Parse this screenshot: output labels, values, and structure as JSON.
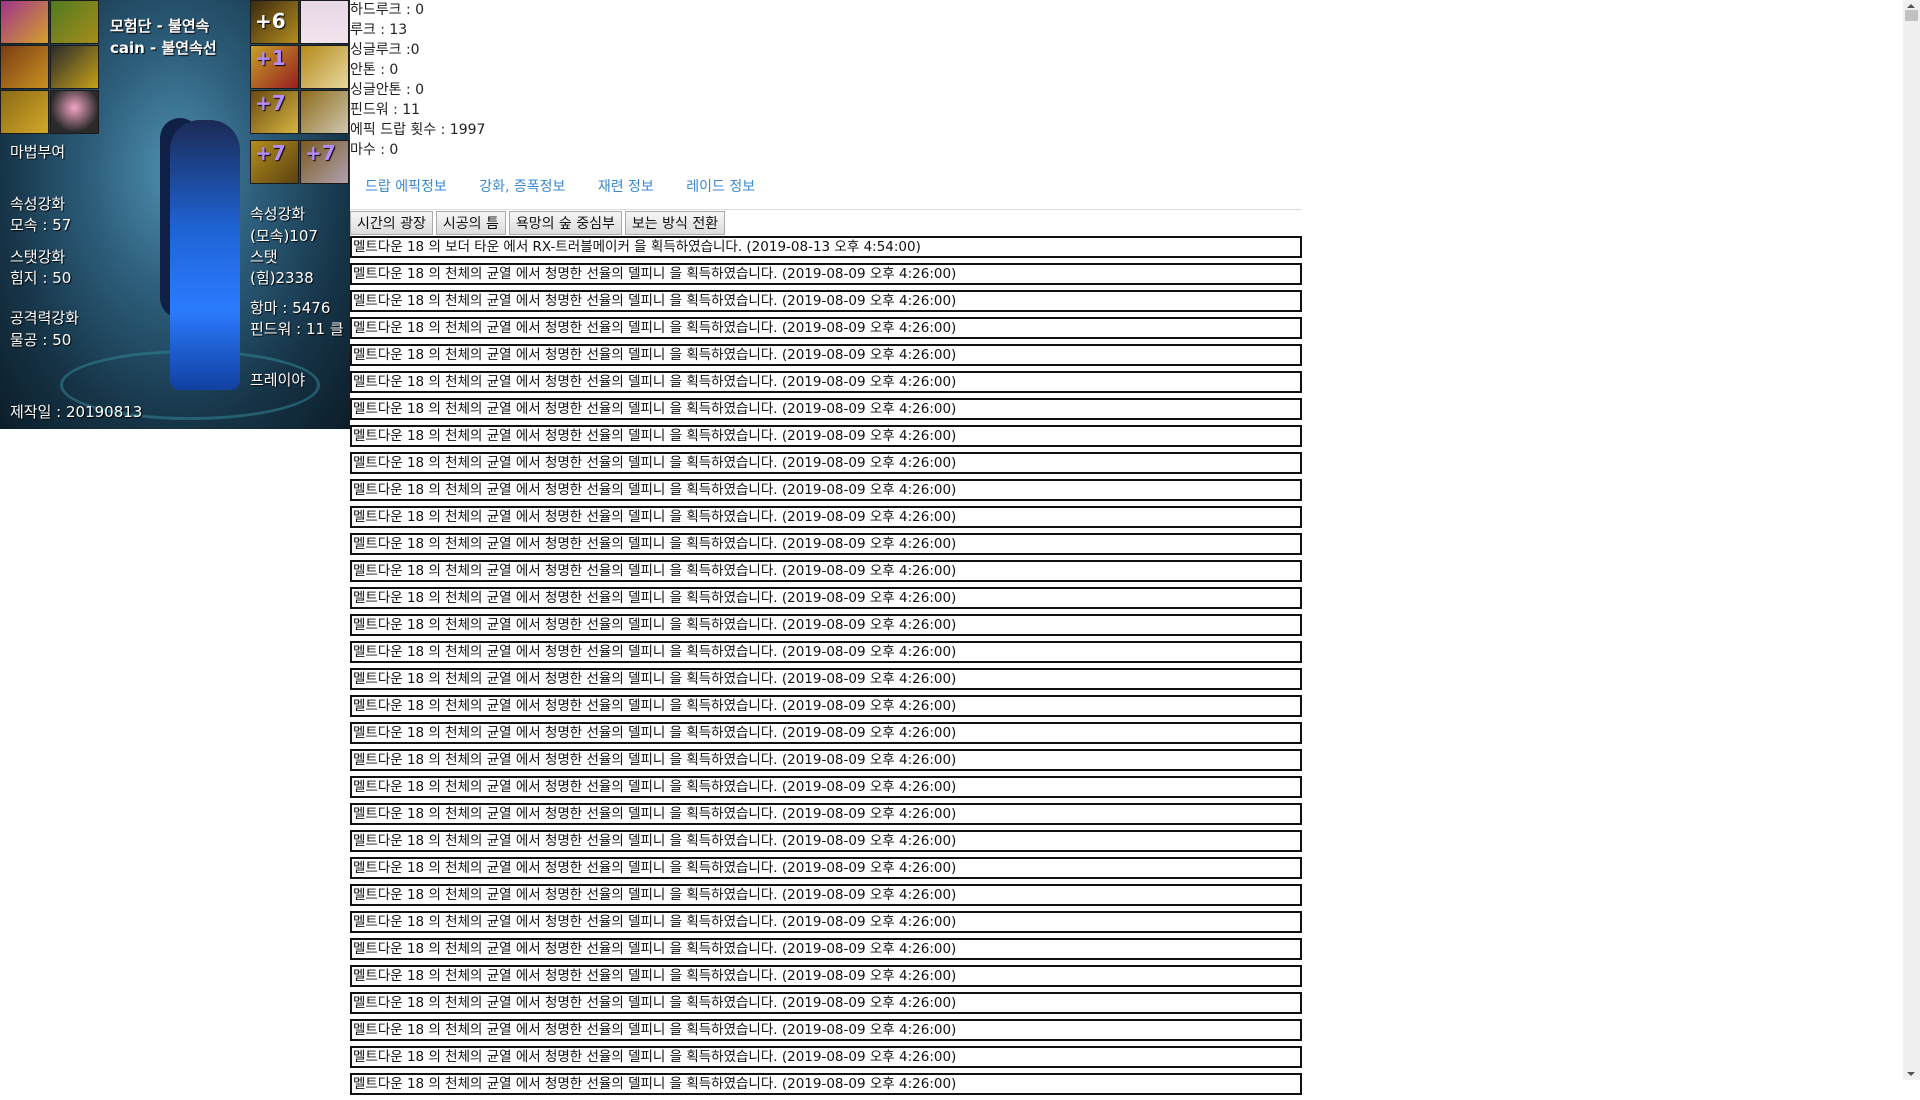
{
  "card": {
    "adventure": "모험단 - 불연속",
    "character": "cain  - 불연속선",
    "enchant_label": "마법부여",
    "left_stats": [
      {
        "title": "속성강화",
        "value": "모속 : 57"
      },
      {
        "title": "스탯강화",
        "value": "힘지 : 50"
      },
      {
        "title": "공격력강화",
        "value": "물공 : 50"
      }
    ],
    "right_stats": [
      "속성강화",
      "(모속)107",
      "스탯",
      "(힘)2338"
    ],
    "anti_magic": "항마 : 5476",
    "fiendwar": "핀드워 : 11 클",
    "class_name": "프레이야",
    "created": "제작일 : 20190813",
    "upgrade_badges": [
      "+6",
      "+1",
      "+7",
      "+7",
      "+7"
    ]
  },
  "stats": [
    "하드루크 : 0",
    "루크 : 13",
    "싱글루크 :0",
    "안톤 : 0",
    "싱글안톤 : 0",
    "핀드워 : 11",
    "에픽 드랍 횟수 : 1997",
    "마수 : 0"
  ],
  "tabs": [
    "드랍 에픽정보",
    "강화, 증폭정보",
    "재련 정보",
    "레이드 정보"
  ],
  "buttons": [
    "시간의 광장",
    "시공의 틈",
    "욕망의 숲 중심부",
    "보는 방식 전환"
  ],
  "log": [
    "멜트다운 18 의 보더 타운 에서 RX-트러블메이커 을 획득하였습니다. (2019-08-13 오후 4:54:00)",
    "멜트다운 18 의 천체의 균열 에서 청명한 선율의 델피니 을 획득하였습니다. (2019-08-09 오후 4:26:00)",
    "멜트다운 18 의 천체의 균열 에서 청명한 선율의 델피니 을 획득하였습니다. (2019-08-09 오후 4:26:00)",
    "멜트다운 18 의 천체의 균열 에서 청명한 선율의 델피니 을 획득하였습니다. (2019-08-09 오후 4:26:00)",
    "멜트다운 18 의 천체의 균열 에서 청명한 선율의 델피니 을 획득하였습니다. (2019-08-09 오후 4:26:00)",
    "멜트다운 18 의 천체의 균열 에서 청명한 선율의 델피니 을 획득하였습니다. (2019-08-09 오후 4:26:00)",
    "멜트다운 18 의 천체의 균열 에서 청명한 선율의 델피니 을 획득하였습니다. (2019-08-09 오후 4:26:00)",
    "멜트다운 18 의 천체의 균열 에서 청명한 선율의 델피니 을 획득하였습니다. (2019-08-09 오후 4:26:00)",
    "멜트다운 18 의 천체의 균열 에서 청명한 선율의 델피니 을 획득하였습니다. (2019-08-09 오후 4:26:00)",
    "멜트다운 18 의 천체의 균열 에서 청명한 선율의 델피니 을 획득하였습니다. (2019-08-09 오후 4:26:00)",
    "멜트다운 18 의 천체의 균열 에서 청명한 선율의 델피니 을 획득하였습니다. (2019-08-09 오후 4:26:00)",
    "멜트다운 18 의 천체의 균열 에서 청명한 선율의 델피니 을 획득하였습니다. (2019-08-09 오후 4:26:00)",
    "멜트다운 18 의 천체의 균열 에서 청명한 선율의 델피니 을 획득하였습니다. (2019-08-09 오후 4:26:00)",
    "멜트다운 18 의 천체의 균열 에서 청명한 선율의 델피니 을 획득하였습니다. (2019-08-09 오후 4:26:00)",
    "멜트다운 18 의 천체의 균열 에서 청명한 선율의 델피니 을 획득하였습니다. (2019-08-09 오후 4:26:00)",
    "멜트다운 18 의 천체의 균열 에서 청명한 선율의 델피니 을 획득하였습니다. (2019-08-09 오후 4:26:00)",
    "멜트다운 18 의 천체의 균열 에서 청명한 선율의 델피니 을 획득하였습니다. (2019-08-09 오후 4:26:00)",
    "멜트다운 18 의 천체의 균열 에서 청명한 선율의 델피니 을 획득하였습니다. (2019-08-09 오후 4:26:00)",
    "멜트다운 18 의 천체의 균열 에서 청명한 선율의 델피니 을 획득하였습니다. (2019-08-09 오후 4:26:00)",
    "멜트다운 18 의 천체의 균열 에서 청명한 선율의 델피니 을 획득하였습니다. (2019-08-09 오후 4:26:00)",
    "멜트다운 18 의 천체의 균열 에서 청명한 선율의 델피니 을 획득하였습니다. (2019-08-09 오후 4:26:00)",
    "멜트다운 18 의 천체의 균열 에서 청명한 선율의 델피니 을 획득하였습니다. (2019-08-09 오후 4:26:00)",
    "멜트다운 18 의 천체의 균열 에서 청명한 선율의 델피니 을 획득하였습니다. (2019-08-09 오후 4:26:00)",
    "멜트다운 18 의 천체의 균열 에서 청명한 선율의 델피니 을 획득하였습니다. (2019-08-09 오후 4:26:00)",
    "멜트다운 18 의 천체의 균열 에서 청명한 선율의 델피니 을 획득하였습니다. (2019-08-09 오후 4:26:00)",
    "멜트다운 18 의 천체의 균열 에서 청명한 선율의 델피니 을 획득하였습니다. (2019-08-09 오후 4:26:00)",
    "멜트다운 18 의 천체의 균열 에서 청명한 선율의 델피니 을 획득하였습니다. (2019-08-09 오후 4:26:00)",
    "멜트다운 18 의 천체의 균열 에서 청명한 선율의 델피니 을 획득하였습니다. (2019-08-09 오후 4:26:00)",
    "멜트다운 18 의 천체의 균열 에서 청명한 선율의 델피니 을 획득하였습니다. (2019-08-09 오후 4:26:00)",
    "멜트다운 18 의 천체의 균열 에서 청명한 선율의 델피니 을 획득하였습니다. (2019-08-09 오후 4:26:00)",
    "멜트다운 18 의 천체의 균열 에서 청명한 선율의 델피니 을 획득하였습니다. (2019-08-09 오후 4:26:00)",
    "멜트다운 18 의 천체의 균열 에서 청명한 선율의 델피니 을 획득하였습니다. (2019-08-09 오후 4:26:00)"
  ],
  "colors": {
    "tab_link": "#3b8ad0",
    "row_border": "#111111",
    "scrollbar_track": "#f0f0f0",
    "scrollbar_thumb": "#c1c1c1"
  }
}
